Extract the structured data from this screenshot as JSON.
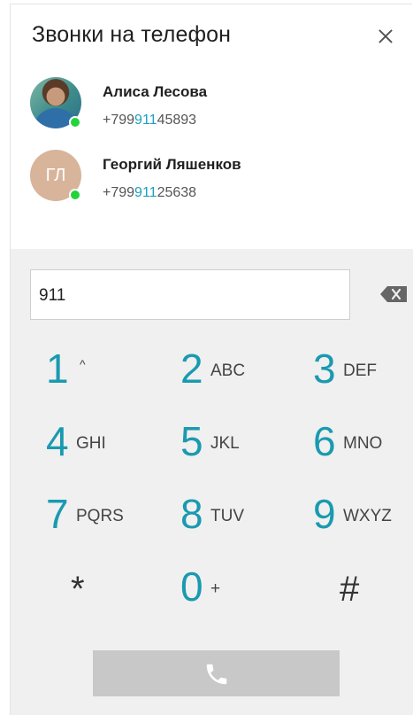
{
  "header": {
    "title": "Звонки на телефон",
    "close_icon": "close-icon"
  },
  "contacts": [
    {
      "name": "Алиса Лесова",
      "phone_prefix": "+799",
      "phone_match": "911",
      "phone_suffix": "45893",
      "online": true
    },
    {
      "name": "Георгий Ляшенков",
      "initials": "ГЛ",
      "phone_prefix": "+799",
      "phone_match": "911",
      "phone_suffix": "25638",
      "online": true
    }
  ],
  "dialer": {
    "input_value": "911",
    "backspace_icon": "backspace-icon",
    "keys": [
      {
        "digit": "1",
        "letters": "^"
      },
      {
        "digit": "2",
        "letters": "ABC"
      },
      {
        "digit": "3",
        "letters": "DEF"
      },
      {
        "digit": "4",
        "letters": "GHI"
      },
      {
        "digit": "5",
        "letters": "JKL"
      },
      {
        "digit": "6",
        "letters": "MNO"
      },
      {
        "digit": "7",
        "letters": "PQRS"
      },
      {
        "digit": "8",
        "letters": "TUV"
      },
      {
        "digit": "9",
        "letters": "WXYZ"
      },
      {
        "digit": "*",
        "letters": ""
      },
      {
        "digit": "0",
        "letters": "+"
      },
      {
        "digit": "#",
        "letters": ""
      }
    ],
    "call_icon": "phone-icon"
  },
  "colors": {
    "accent": "#1a9ab0",
    "online": "#22d43a",
    "dialer_bg": "#f0f0f0",
    "call_button": "#c8c8c8"
  }
}
